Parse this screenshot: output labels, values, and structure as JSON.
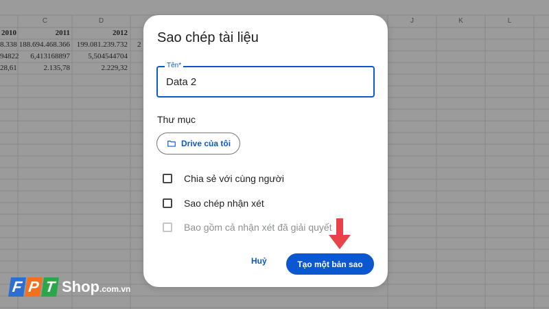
{
  "sheet": {
    "columns": [
      "C",
      "D",
      "J",
      "K",
      "L"
    ],
    "header_row": [
      "2010",
      "2011",
      "2012"
    ],
    "rows": [
      [
        "8.338",
        "188.694.468.366",
        "199.081.239.732",
        "2"
      ],
      [
        "94822",
        "6,413168897",
        "5,504544704"
      ],
      [
        "28,61",
        "2.135,78",
        "2.229,32"
      ]
    ]
  },
  "dialog": {
    "title": "Sao chép tài liệu",
    "name_label": "Tên*",
    "name_value": "Data 2",
    "folder_heading": "Thư mục",
    "folder_button": "Drive của tôi",
    "options": [
      {
        "label": "Chia sẻ với cùng người",
        "checked": false,
        "disabled": false
      },
      {
        "label": "Sao chép nhận xét",
        "checked": false,
        "disabled": false
      },
      {
        "label": "Bao gồm cả nhận xét đã giải quyết",
        "checked": false,
        "disabled": true
      }
    ],
    "cancel_label": "Huỷ",
    "confirm_label": "Tạo một bản sao"
  },
  "logo": {
    "letters": [
      "F",
      "P",
      "T"
    ],
    "word": "Shop",
    "domain": ".com.vn",
    "colors": [
      "#2c6fd1",
      "#f37021",
      "#2aa748"
    ]
  },
  "colors": {
    "accent": "#0b57d0",
    "arrow": "#e8434a"
  }
}
